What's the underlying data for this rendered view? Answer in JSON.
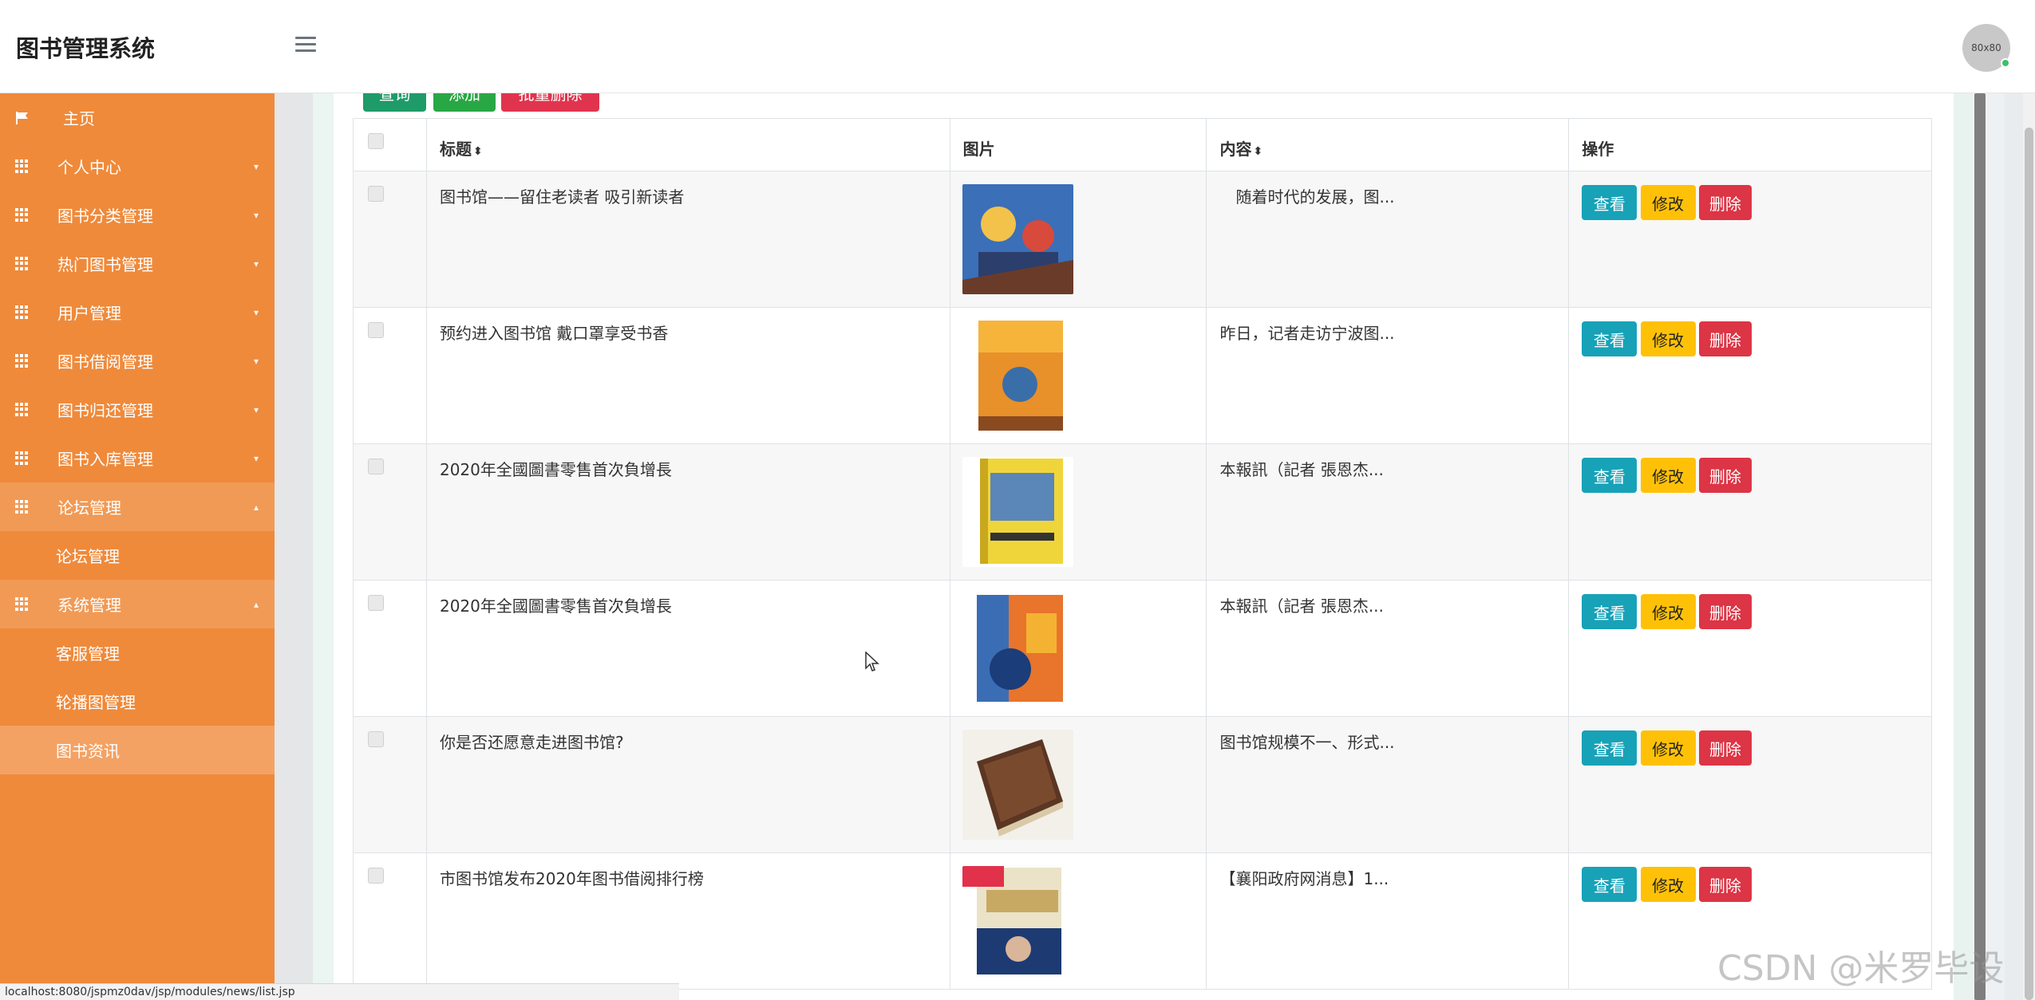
{
  "header": {
    "brand": "图书管理系统",
    "avatar_text": "80x80"
  },
  "sidebar": {
    "items": [
      {
        "label": "主页",
        "icon": "flag-icon"
      },
      {
        "label": "个人中心",
        "icon": "grid-icon"
      },
      {
        "label": "图书分类管理",
        "icon": "grid-icon"
      },
      {
        "label": "热门图书管理",
        "icon": "grid-icon"
      },
      {
        "label": "用户管理",
        "icon": "grid-icon"
      },
      {
        "label": "图书借阅管理",
        "icon": "grid-icon"
      },
      {
        "label": "图书归还管理",
        "icon": "grid-icon"
      },
      {
        "label": "图书入库管理",
        "icon": "grid-icon"
      },
      {
        "label": "论坛管理",
        "icon": "grid-icon"
      },
      {
        "label": "系统管理",
        "icon": "grid-icon"
      }
    ],
    "forum_sub": [
      "论坛管理"
    ],
    "system_sub": [
      "客服管理",
      "轮播图管理",
      "图书资讯"
    ]
  },
  "toolbar": {
    "search": "查询",
    "add": "添加",
    "batch_delete": "批量删除"
  },
  "table": {
    "headers": {
      "title": "标题",
      "image": "图片",
      "content": "内容",
      "ops": "操作"
    },
    "rows": [
      {
        "title": "图书馆——留住老读者 吸引新读者",
        "content": "　随着时代的发展，图..."
      },
      {
        "title": "预约进入图书馆 戴口罩享受书香",
        "content": "昨日，记者走访宁波图..."
      },
      {
        "title": "2020年全國圖書零售首次負增長",
        "content": "本報訊（記者 張恩杰..."
      },
      {
        "title": "2020年全國圖書零售首次負增長",
        "content": "本報訊（記者 張恩杰..."
      },
      {
        "title": "你是否还愿意走进图书馆?",
        "content": "图书馆规模不一、形式..."
      },
      {
        "title": "市图书馆发布2020年图书借阅排行榜",
        "content": "【襄阳政府网消息】1..."
      }
    ],
    "op_view": "查看",
    "op_edit": "修改",
    "op_delete": "删除"
  },
  "statusbar": {
    "url": "localhost:8080/jspmz0dav/jsp/modules/news/list.jsp"
  },
  "watermark": "CSDN @米罗毕设",
  "colors": {
    "sidebar": "#ef8a3b",
    "view": "#17a2b8",
    "edit": "#ffc107",
    "delete": "#dc3545"
  }
}
